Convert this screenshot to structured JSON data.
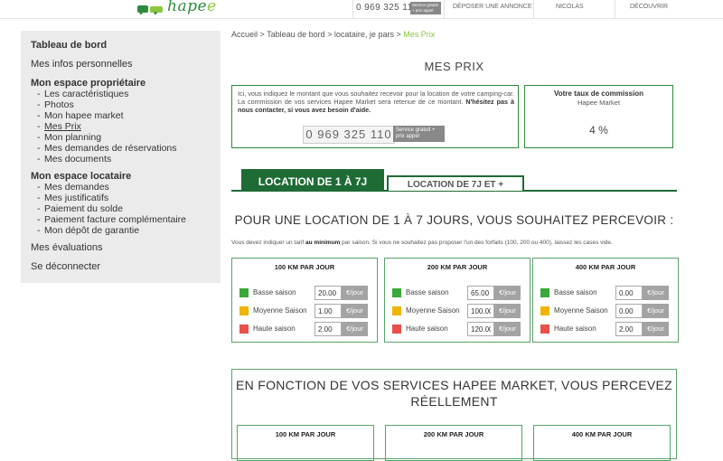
{
  "topbar": {
    "phone": "0 969 325 110",
    "service_tag": "Service gratuit + prix appel",
    "links": [
      "DÉPOSER UNE ANNONCE",
      "NICOLAS",
      "DÉCOUVRIR"
    ]
  },
  "logo": {
    "text_main": "hape",
    "text_end": "e"
  },
  "sidebar": {
    "dashboard": "Tableau de bord",
    "personal": "Mes infos personnelles",
    "owner_head": "Mon espace propriétaire",
    "owner_items": [
      "Les caractéristiques",
      "Photos",
      "Mon hapee market",
      "Mes Prix",
      "Mon planning",
      "Mes demandes de réservations",
      "Mes documents"
    ],
    "tenant_head": "Mon espace locataire",
    "tenant_items": [
      "Mes demandes",
      "Mes justificatifs",
      "Paiement du solde",
      "Paiement facture complémentaire",
      "Mon dépôt de garantie"
    ],
    "reviews": "Mes évaluations",
    "logout": "Se déconnecter"
  },
  "breadcrumb": {
    "part1": "Accueil > Tableau de bord > locataire, je pars > ",
    "current": "Mes Prix"
  },
  "page_title": "MES PRIX",
  "info": {
    "text": "Ici, vous indiquez le montant que vous souhaitez recevoir pour la location de votre camping-car. La commission de vos services Hapee Market sera retenue de ce montant. ",
    "bold": "N'hésitez pas à nous contacter, si vous avez besoin d'aide.",
    "phone": "0 969 325 110",
    "service_tag": "Service gratuit + prix appel"
  },
  "commission": {
    "title": "Votre taux de commission",
    "sub": "Hapee Market",
    "value": "4 %"
  },
  "tabs": [
    "LOCATION DE 1 À 7J",
    "LOCATION DE 7J ET +"
  ],
  "section_title": "POUR UNE LOCATION DE 1 À 7 JOURS, VOUS SOUHAITEZ PERCEVOIR :",
  "hint": {
    "pre": "Vous devez indiquer un tarif ",
    "bold": "au minimum",
    "post": " par saison. Si vous ne souhaitez pas proposer l'un des forfaits (100, 200 ou 400), laissez les cases vide."
  },
  "season_colors": {
    "basse": "#3aa83a",
    "moyenne": "#f0b400",
    "haute": "#e8504a"
  },
  "unit": "€/jour",
  "cards": [
    {
      "title": "100 KM PAR JOUR",
      "rows": [
        {
          "label": "Basse saison",
          "value": "20.00"
        },
        {
          "label": "Moyenne Saison",
          "value": "1.00"
        },
        {
          "label": "Haute saison",
          "value": "2.00"
        }
      ]
    },
    {
      "title": "200 KM PAR JOUR",
      "rows": [
        {
          "label": "Basse saison",
          "value": "65.00"
        },
        {
          "label": "Moyenne Saison",
          "value": "100.00"
        },
        {
          "label": "Haute saison",
          "value": "120.00"
        }
      ]
    },
    {
      "title": "400 KM PAR JOUR",
      "rows": [
        {
          "label": "Basse saison",
          "value": "0.00"
        },
        {
          "label": "Moyenne Saison",
          "value": "0.00"
        },
        {
          "label": "Haute saison",
          "value": "2.00"
        }
      ]
    }
  ],
  "real_section": {
    "title_line1": "EN FONCTION DE VOS SERVICES HAPEE MARKET, VOUS PERCEVEZ",
    "title_line2": "RÉELLEMENT",
    "cards": [
      "100 KM PAR JOUR",
      "200 KM PAR JOUR",
      "400 KM PAR JOUR"
    ]
  }
}
